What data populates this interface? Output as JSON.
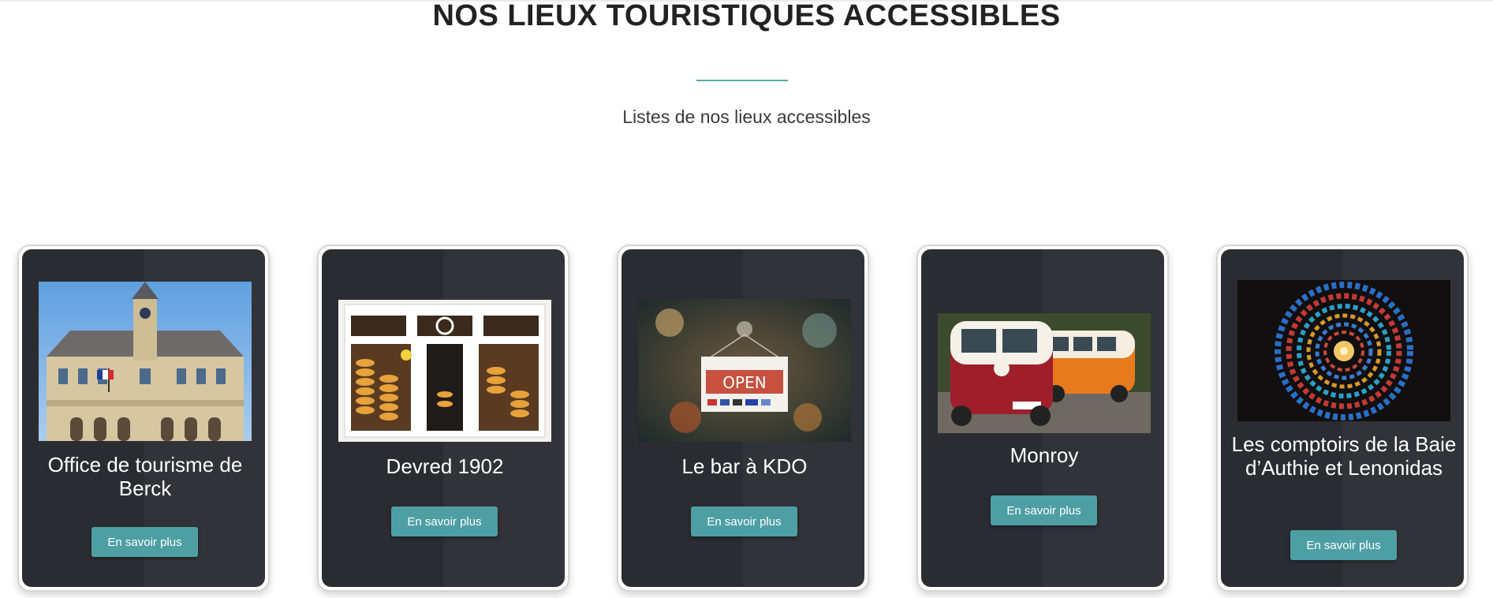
{
  "header": {
    "title": "NOS LIEUX TOURISTIQUES ACCESSIBLES",
    "subtitle": "Listes de nos lieux accessibles",
    "accent_color": "#5aa9a8"
  },
  "cards": [
    {
      "title": "Office de tourisme de Berck",
      "button": "En savoir plus",
      "image": "town-hall-building-photo"
    },
    {
      "title": "Devred 1902",
      "button": "En savoir plus",
      "image": "cheese-shop-storefront-photo"
    },
    {
      "title": "Le bar à KDO",
      "button": "En savoir plus",
      "image": "open-sign-photo"
    },
    {
      "title": "Monroy",
      "button": "En savoir plus",
      "image": "vw-vans-photo"
    },
    {
      "title": "Les comptoirs de la Baie d’Authie et Lenonidas",
      "button": "En savoir plus",
      "image": "stained-glass-spiral-photo"
    }
  ],
  "colors": {
    "card_background": "#2b2c31",
    "button_background": "#4e9fa4"
  }
}
